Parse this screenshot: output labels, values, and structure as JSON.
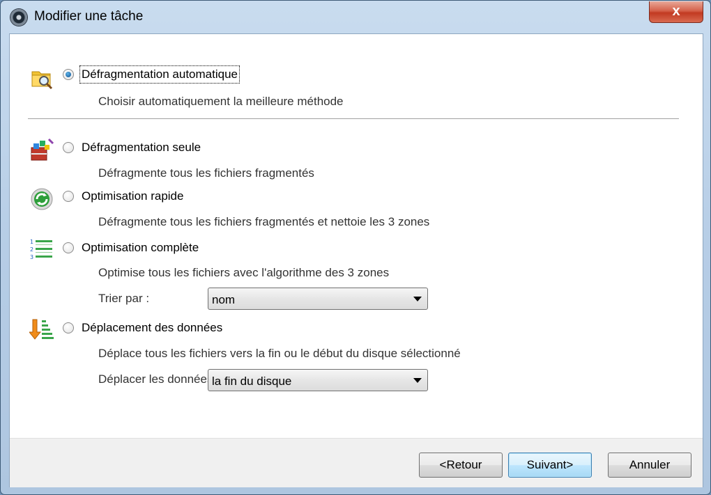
{
  "window": {
    "title": "Modifier une tâche",
    "close_symbol": "x"
  },
  "options": [
    {
      "label": "Défragmentation automatique",
      "description": "Choisir automatiquement la meilleure méthode",
      "checked": true,
      "icon": "folder-search-icon"
    },
    {
      "label": "Défragmentation seule",
      "description": "Défragmente tous les fichiers fragmentés",
      "checked": false,
      "icon": "defrag-blocks-icon"
    },
    {
      "label": "Optimisation rapide",
      "description": "Défragmente tous les fichiers fragmentés et nettoie les 3 zones",
      "checked": false,
      "icon": "refresh-icon"
    },
    {
      "label": "Optimisation complète",
      "description": "Optimise tous les fichiers avec l'algorithme des 3 zones",
      "checked": false,
      "icon": "numbered-list-icon"
    },
    {
      "label": "Déplacement des données",
      "description": "Déplace tous les fichiers vers la fin ou le début du disque sélectionné",
      "checked": false,
      "icon": "sort-down-icon"
    }
  ],
  "sort": {
    "label": "Trier par :",
    "value": "nom"
  },
  "move": {
    "label": "Déplacer les données",
    "value": "la fin du disque"
  },
  "buttons": {
    "back": "<Retour",
    "next": "Suivant>",
    "cancel": "Annuler"
  },
  "colors": {
    "accent": "#3c7fb1",
    "titlebar": "#b6cde6",
    "close": "#c23a22",
    "footer": "#f0f0f0"
  }
}
